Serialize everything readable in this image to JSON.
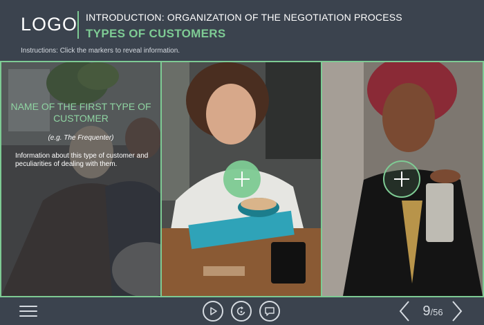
{
  "header": {
    "logo": "LOGO",
    "course_title": "INTRODUCTION: ORGANIZATION OF THE NEGOTIATION PROCESS",
    "slide_title": "TYPES OF CUSTOMERS",
    "instructions": "Instructions: Click the markers to reveal information."
  },
  "panels": [
    {
      "type_name": "NAME OF THE FIRST TYPE OF CUSTOMER",
      "example": "(e.g. The Frequenter)",
      "info": "Information about this type of customer and peculiarities of dealing with them.",
      "revealed": true
    },
    {
      "marker_state": "default",
      "marker_icon": "plus-icon"
    },
    {
      "marker_state": "hover",
      "marker_icon": "plus-icon"
    }
  ],
  "footer": {
    "menu_icon": "hamburger-menu-icon",
    "play_icon": "play-icon",
    "replay_icon": "replay-icon",
    "comment_icon": "comment-icon",
    "prev_icon": "chevron-left-icon",
    "next_icon": "chevron-right-icon",
    "page_current": "9",
    "page_sep": "/",
    "page_total": "56"
  },
  "colors": {
    "background": "#3b434e",
    "accent": "#7ecb94",
    "text": "#ffffff",
    "muted": "#d6dbe1"
  }
}
